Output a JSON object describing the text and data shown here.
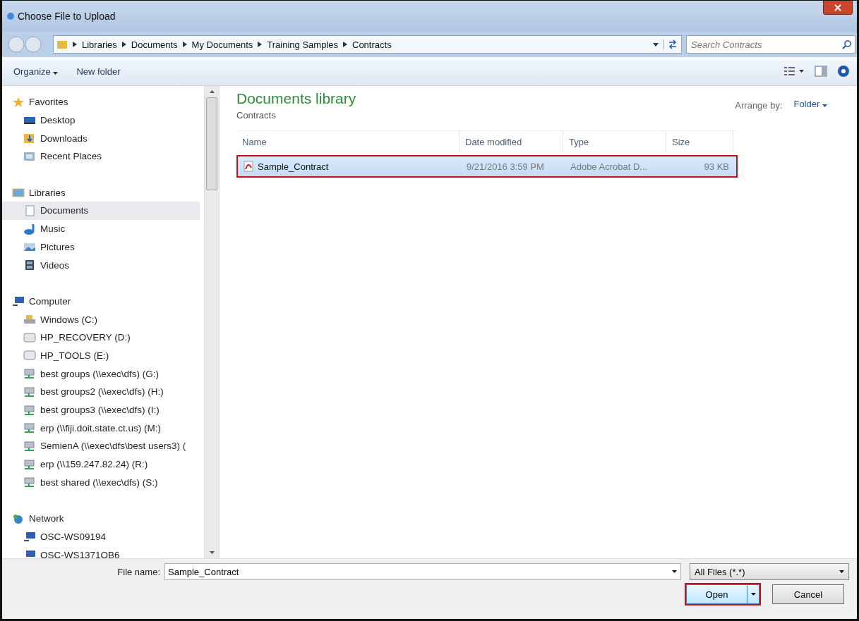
{
  "window": {
    "title": "Choose File to Upload"
  },
  "address": {
    "crumbs": [
      "Libraries",
      "Documents",
      "My Documents",
      "Training Samples",
      "Contracts"
    ],
    "search_placeholder": "Search Contracts"
  },
  "toolbar": {
    "organize": "Organize",
    "new_folder": "New folder"
  },
  "sidebar": {
    "sections": [
      {
        "label": "Favorites",
        "kind": "star",
        "children": [
          {
            "label": "Desktop",
            "kind": "desktop",
            "selected": false
          },
          {
            "label": "Downloads",
            "kind": "downloads",
            "selected": false
          },
          {
            "label": "Recent Places",
            "kind": "recent",
            "selected": false
          }
        ]
      },
      {
        "label": "Libraries",
        "kind": "library",
        "children": [
          {
            "label": "Documents",
            "kind": "document",
            "selected": true
          },
          {
            "label": "Music",
            "kind": "music",
            "selected": false
          },
          {
            "label": "Pictures",
            "kind": "pictures",
            "selected": false
          },
          {
            "label": "Videos",
            "kind": "videos",
            "selected": false
          }
        ]
      },
      {
        "label": "Computer",
        "kind": "computer",
        "children": [
          {
            "label": "Windows  (C:)",
            "kind": "windrive",
            "selected": false
          },
          {
            "label": "HP_RECOVERY (D:)",
            "kind": "drive",
            "selected": false
          },
          {
            "label": "HP_TOOLS (E:)",
            "kind": "drive",
            "selected": false
          },
          {
            "label": "best groups (\\\\exec\\dfs) (G:)",
            "kind": "netdrive",
            "selected": false
          },
          {
            "label": "best groups2 (\\\\exec\\dfs) (H:)",
            "kind": "netdrive",
            "selected": false
          },
          {
            "label": "best groups3 (\\\\exec\\dfs) (I:)",
            "kind": "netdrive",
            "selected": false
          },
          {
            "label": "erp (\\\\fiji.doit.state.ct.us) (M:)",
            "kind": "netdrive",
            "selected": false
          },
          {
            "label": "SemienA (\\\\exec\\dfs\\best users3) (",
            "kind": "netdrive",
            "selected": false
          },
          {
            "label": "erp (\\\\159.247.82.24) (R:)",
            "kind": "netdrive",
            "selected": false
          },
          {
            "label": "best shared (\\\\exec\\dfs) (S:)",
            "kind": "netdrive",
            "selected": false
          }
        ]
      },
      {
        "label": "Network",
        "kind": "network",
        "children": [
          {
            "label": "OSC-WS09194",
            "kind": "pc",
            "selected": false
          },
          {
            "label": "OSC-WS1371OB6",
            "kind": "pc",
            "selected": false
          }
        ]
      }
    ]
  },
  "content": {
    "title": "Documents library",
    "subtitle": "Contracts",
    "arrange_label": "Arrange by:",
    "arrange_value": "Folder",
    "columns": [
      "Name",
      "Date modified",
      "Type",
      "Size"
    ],
    "rows": [
      {
        "name": "Sample_Contract",
        "date": "9/21/2016 3:59 PM",
        "type": "Adobe Acrobat D...",
        "size": "93 KB",
        "selected": true,
        "highlighted": true
      }
    ]
  },
  "footer": {
    "file_name_label": "File name:",
    "file_name": "Sample_Contract",
    "filter": "All Files (*.*)",
    "open": "Open",
    "open_highlighted": true,
    "cancel": "Cancel"
  }
}
